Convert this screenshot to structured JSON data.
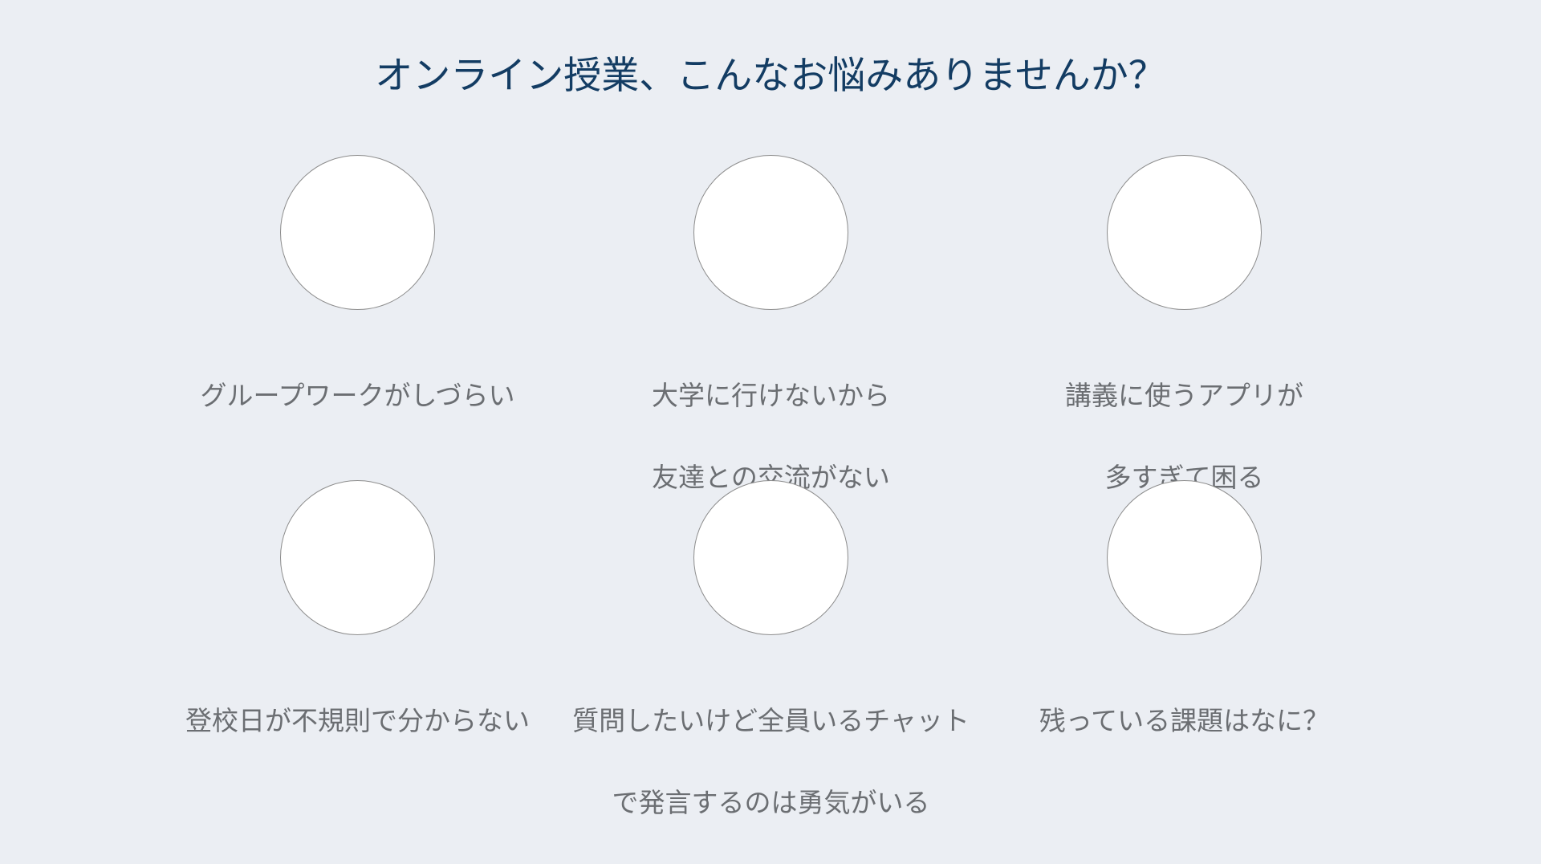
{
  "heading": "オンライン授業、こんなお悩みありませんか？",
  "problems": [
    {
      "lines": [
        "グループワークがしづらい"
      ]
    },
    {
      "lines": [
        "大学に行けないから",
        "友達との交流がない"
      ]
    },
    {
      "lines": [
        "講義に使うアプリが",
        "多すぎて困る"
      ]
    },
    {
      "lines": [
        "登校日が不規則で分からない"
      ]
    },
    {
      "lines": [
        "質問したいけど全員いるチャット",
        "で発言するのは勇気がいる"
      ]
    },
    {
      "lines": [
        "残っている課題はなに？"
      ]
    }
  ],
  "colors": {
    "background": "#ebeef3",
    "heading": "#133c63",
    "caption": "#6b6e72",
    "circle_fill": "#ffffff",
    "circle_border": "#8c8c8c"
  }
}
